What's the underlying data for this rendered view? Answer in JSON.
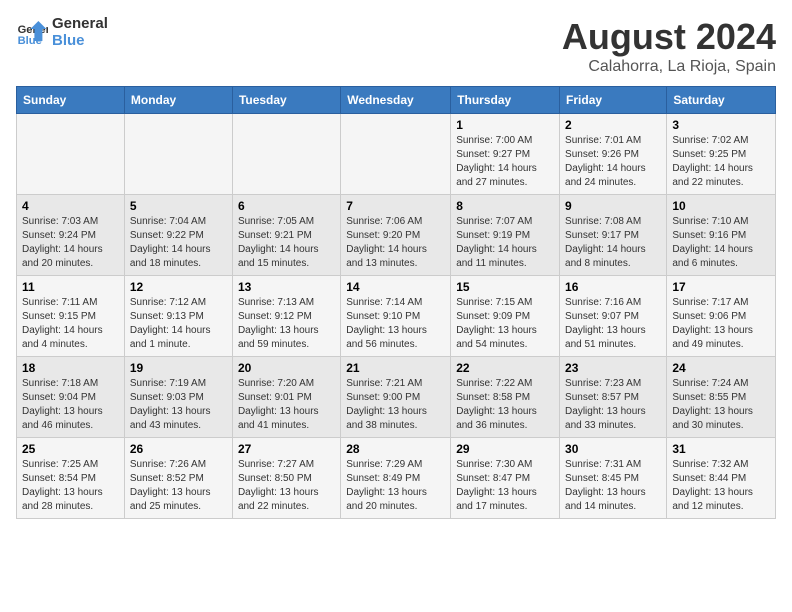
{
  "logo": {
    "line1": "General",
    "line2": "Blue"
  },
  "title": "August 2024",
  "subtitle": "Calahorra, La Rioja, Spain",
  "weekdays": [
    "Sunday",
    "Monday",
    "Tuesday",
    "Wednesday",
    "Thursday",
    "Friday",
    "Saturday"
  ],
  "weeks": [
    [
      {
        "day": "",
        "info": ""
      },
      {
        "day": "",
        "info": ""
      },
      {
        "day": "",
        "info": ""
      },
      {
        "day": "",
        "info": ""
      },
      {
        "day": "1",
        "info": "Sunrise: 7:00 AM\nSunset: 9:27 PM\nDaylight: 14 hours and 27 minutes."
      },
      {
        "day": "2",
        "info": "Sunrise: 7:01 AM\nSunset: 9:26 PM\nDaylight: 14 hours and 24 minutes."
      },
      {
        "day": "3",
        "info": "Sunrise: 7:02 AM\nSunset: 9:25 PM\nDaylight: 14 hours and 22 minutes."
      }
    ],
    [
      {
        "day": "4",
        "info": "Sunrise: 7:03 AM\nSunset: 9:24 PM\nDaylight: 14 hours and 20 minutes."
      },
      {
        "day": "5",
        "info": "Sunrise: 7:04 AM\nSunset: 9:22 PM\nDaylight: 14 hours and 18 minutes."
      },
      {
        "day": "6",
        "info": "Sunrise: 7:05 AM\nSunset: 9:21 PM\nDaylight: 14 hours and 15 minutes."
      },
      {
        "day": "7",
        "info": "Sunrise: 7:06 AM\nSunset: 9:20 PM\nDaylight: 14 hours and 13 minutes."
      },
      {
        "day": "8",
        "info": "Sunrise: 7:07 AM\nSunset: 9:19 PM\nDaylight: 14 hours and 11 minutes."
      },
      {
        "day": "9",
        "info": "Sunrise: 7:08 AM\nSunset: 9:17 PM\nDaylight: 14 hours and 8 minutes."
      },
      {
        "day": "10",
        "info": "Sunrise: 7:10 AM\nSunset: 9:16 PM\nDaylight: 14 hours and 6 minutes."
      }
    ],
    [
      {
        "day": "11",
        "info": "Sunrise: 7:11 AM\nSunset: 9:15 PM\nDaylight: 14 hours and 4 minutes."
      },
      {
        "day": "12",
        "info": "Sunrise: 7:12 AM\nSunset: 9:13 PM\nDaylight: 14 hours and 1 minute."
      },
      {
        "day": "13",
        "info": "Sunrise: 7:13 AM\nSunset: 9:12 PM\nDaylight: 13 hours and 59 minutes."
      },
      {
        "day": "14",
        "info": "Sunrise: 7:14 AM\nSunset: 9:10 PM\nDaylight: 13 hours and 56 minutes."
      },
      {
        "day": "15",
        "info": "Sunrise: 7:15 AM\nSunset: 9:09 PM\nDaylight: 13 hours and 54 minutes."
      },
      {
        "day": "16",
        "info": "Sunrise: 7:16 AM\nSunset: 9:07 PM\nDaylight: 13 hours and 51 minutes."
      },
      {
        "day": "17",
        "info": "Sunrise: 7:17 AM\nSunset: 9:06 PM\nDaylight: 13 hours and 49 minutes."
      }
    ],
    [
      {
        "day": "18",
        "info": "Sunrise: 7:18 AM\nSunset: 9:04 PM\nDaylight: 13 hours and 46 minutes."
      },
      {
        "day": "19",
        "info": "Sunrise: 7:19 AM\nSunset: 9:03 PM\nDaylight: 13 hours and 43 minutes."
      },
      {
        "day": "20",
        "info": "Sunrise: 7:20 AM\nSunset: 9:01 PM\nDaylight: 13 hours and 41 minutes."
      },
      {
        "day": "21",
        "info": "Sunrise: 7:21 AM\nSunset: 9:00 PM\nDaylight: 13 hours and 38 minutes."
      },
      {
        "day": "22",
        "info": "Sunrise: 7:22 AM\nSunset: 8:58 PM\nDaylight: 13 hours and 36 minutes."
      },
      {
        "day": "23",
        "info": "Sunrise: 7:23 AM\nSunset: 8:57 PM\nDaylight: 13 hours and 33 minutes."
      },
      {
        "day": "24",
        "info": "Sunrise: 7:24 AM\nSunset: 8:55 PM\nDaylight: 13 hours and 30 minutes."
      }
    ],
    [
      {
        "day": "25",
        "info": "Sunrise: 7:25 AM\nSunset: 8:54 PM\nDaylight: 13 hours and 28 minutes."
      },
      {
        "day": "26",
        "info": "Sunrise: 7:26 AM\nSunset: 8:52 PM\nDaylight: 13 hours and 25 minutes."
      },
      {
        "day": "27",
        "info": "Sunrise: 7:27 AM\nSunset: 8:50 PM\nDaylight: 13 hours and 22 minutes."
      },
      {
        "day": "28",
        "info": "Sunrise: 7:29 AM\nSunset: 8:49 PM\nDaylight: 13 hours and 20 minutes."
      },
      {
        "day": "29",
        "info": "Sunrise: 7:30 AM\nSunset: 8:47 PM\nDaylight: 13 hours and 17 minutes."
      },
      {
        "day": "30",
        "info": "Sunrise: 7:31 AM\nSunset: 8:45 PM\nDaylight: 13 hours and 14 minutes."
      },
      {
        "day": "31",
        "info": "Sunrise: 7:32 AM\nSunset: 8:44 PM\nDaylight: 13 hours and 12 minutes."
      }
    ]
  ]
}
